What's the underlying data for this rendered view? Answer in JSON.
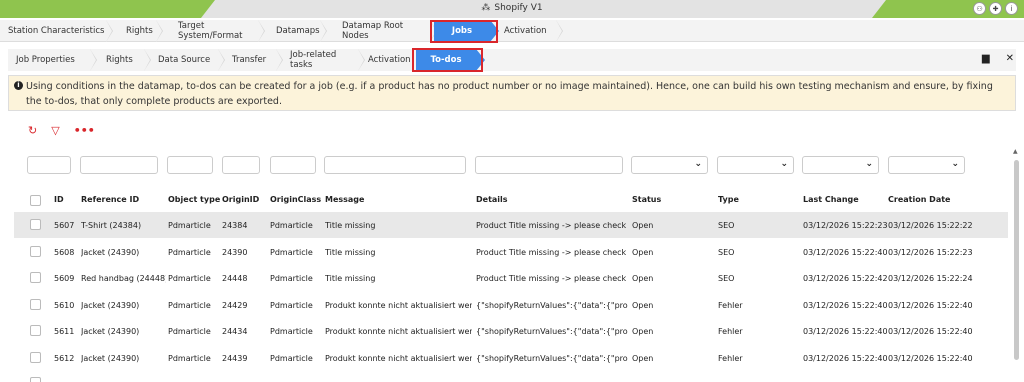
{
  "window": {
    "title": "Shopify V1",
    "title_icon": "network-icon"
  },
  "titlebar_buttons": [
    "connection-icon",
    "pin-icon",
    "info-icon"
  ],
  "breadcrumb_top": [
    "Station Characteristics",
    "Rights",
    "Target System/Format",
    "Datamaps",
    "Datamap Root Nodes",
    "Jobs",
    "Activation"
  ],
  "breadcrumb_top_active": "Jobs",
  "breadcrumb_sub": [
    "Job Properties",
    "Rights",
    "Data Source",
    "Transfer",
    "Job-related tasks",
    "Activation",
    "To-dos"
  ],
  "breadcrumb_sub_active": "To-dos",
  "info_text": "Using conditions in the datamap, to-dos can be created for a job (e.g. if a product has no product number or no image maintained). Hence, one can build his own testing mechanism and ensure, by fixing the to-dos, that only complete products are exported.",
  "toolbar": [
    "refresh-icon",
    "filter-icon",
    "more-icon"
  ],
  "table": {
    "columns": [
      "ID",
      "Reference ID",
      "Object type",
      "OriginID",
      "OriginClass",
      "Message",
      "Details",
      "Status",
      "Type",
      "Last Change",
      "Creation Date"
    ],
    "rows": [
      [
        "5607",
        "T-Shirt (24384)",
        "Pdmarticle",
        "24384",
        "Pdmarticle",
        "Title missing",
        "Product Title missing -> please check",
        "Open",
        "SEO",
        "03/12/2026 15:22:23",
        "03/12/2026 15:22:22"
      ],
      [
        "5608",
        "Jacket (24390)",
        "Pdmarticle",
        "24390",
        "Pdmarticle",
        "Title missing",
        "Product Title missing -> please check",
        "Open",
        "SEO",
        "03/12/2026 15:22:40",
        "03/12/2026 15:22:23"
      ],
      [
        "5609",
        "Red handbag (24448)",
        "Pdmarticle",
        "24448",
        "Pdmarticle",
        "Title missing",
        "Product Title missing -> please check",
        "Open",
        "SEO",
        "03/12/2026 15:22:42",
        "03/12/2026 15:22:24"
      ],
      [
        "5610",
        "Jacket (24390)",
        "Pdmarticle",
        "24429",
        "Pdmarticle",
        "Produkt konnte nicht aktualisiert wer...",
        "{\"shopifyReturnValues\":{\"data\":{\"prod...",
        "Open",
        "Fehler",
        "03/12/2026 15:22:40",
        "03/12/2026 15:22:40"
      ],
      [
        "5611",
        "Jacket (24390)",
        "Pdmarticle",
        "24434",
        "Pdmarticle",
        "Produkt konnte nicht aktualisiert wer...",
        "{\"shopifyReturnValues\":{\"data\":{\"prod...",
        "Open",
        "Fehler",
        "03/12/2026 15:22:40",
        "03/12/2026 15:22:40"
      ],
      [
        "5612",
        "Jacket (24390)",
        "Pdmarticle",
        "24439",
        "Pdmarticle",
        "Produkt konnte nicht aktualisiert wer...",
        "{\"shopifyReturnValues\":{\"data\":{\"prod...",
        "Open",
        "Fehler",
        "03/12/2026 15:22:40",
        "03/12/2026 15:22:40"
      ]
    ],
    "highlighted_row": 0
  },
  "colors": {
    "accent": "#3d8ae8",
    "highlight_border": "#d9262b",
    "brand_green": "#8fc44e",
    "info_background": "#fcf3da"
  }
}
